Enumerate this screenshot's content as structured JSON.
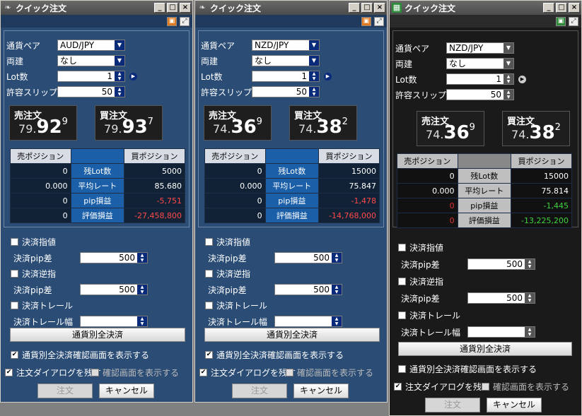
{
  "windows": [
    {
      "theme": "blue",
      "title": "クイック注文",
      "minimize_glyph": "_",
      "restore_glyph": "□",
      "close_glyph": "×",
      "pair_label": "通貨ペア",
      "pair_value": "AUD/JPY",
      "hedge_label": "両建",
      "hedge_value": "なし",
      "lot_label": "Lot数",
      "lot_value": "1",
      "slip_label": "許容スリップ",
      "slip_value": "50",
      "sell_title": "売注文",
      "sell_p1": "79.",
      "sell_p2": "92",
      "sell_p3": "9",
      "buy_title": "買注文",
      "buy_p1": "79.",
      "buy_p2": "93",
      "buy_p3": "7",
      "pos_header_sell": "売ポジション",
      "pos_header_buy": "買ポジション",
      "pos_rows": [
        {
          "sell": "0",
          "label": "残Lot数",
          "buy": "5000"
        },
        {
          "sell": "0.000",
          "label": "平均レート",
          "buy": "85.680"
        },
        {
          "sell": "0",
          "label": "pip損益",
          "buy": "-5,751"
        },
        {
          "sell": "0",
          "label": "評価損益",
          "buy": "-27,458,800"
        }
      ],
      "limit_label": "決済指値",
      "limit_pip_label": "決済pip差",
      "limit_pip_value": "500",
      "stop_label": "決済逆指",
      "stop_pip_label": "決済pip差",
      "stop_pip_value": "500",
      "trail_label": "決済トレール",
      "trail_width_label": "決済トレール幅",
      "trail_width_value": "",
      "close_all_label": "通貨別全決済",
      "show_confirm_closeall_label": "通貨別全決済確認画面を表示する",
      "keep_dialog_label": "注文ダイアログを残す",
      "show_confirm_label": "確認画面を表示する",
      "order_label": "注文",
      "cancel_label": "キャンセル"
    },
    {
      "theme": "blue",
      "title": "クイック注文",
      "minimize_glyph": "_",
      "restore_glyph": "□",
      "close_glyph": "×",
      "pair_label": "通貨ペア",
      "pair_value": "NZD/JPY",
      "hedge_label": "両建",
      "hedge_value": "なし",
      "lot_label": "Lot数",
      "lot_value": "1",
      "slip_label": "許容スリップ",
      "slip_value": "50",
      "sell_title": "売注文",
      "sell_p1": "74.",
      "sell_p2": "36",
      "sell_p3": "9",
      "buy_title": "買注文",
      "buy_p1": "74.",
      "buy_p2": "38",
      "buy_p3": "2",
      "pos_header_sell": "売ポジション",
      "pos_header_buy": "買ポジション",
      "pos_rows": [
        {
          "sell": "0",
          "label": "残Lot数",
          "buy": "15000"
        },
        {
          "sell": "0.000",
          "label": "平均レート",
          "buy": "75.847"
        },
        {
          "sell": "0",
          "label": "pip損益",
          "buy": "-1,478"
        },
        {
          "sell": "0",
          "label": "評価損益",
          "buy": "-14,768,000"
        }
      ],
      "limit_label": "決済指値",
      "limit_pip_label": "決済pip差",
      "limit_pip_value": "500",
      "stop_label": "決済逆指",
      "stop_pip_label": "決済pip差",
      "stop_pip_value": "500",
      "trail_label": "決済トレール",
      "trail_width_label": "決済トレール幅",
      "trail_width_value": "",
      "close_all_label": "通貨別全決済",
      "show_confirm_closeall_label": "通貨別全決済確認画面を表示する",
      "keep_dialog_label": "注文ダイアログを残す",
      "show_confirm_label": "確認画面を表示する",
      "order_label": "注文",
      "cancel_label": "キャンセル"
    },
    {
      "theme": "dark",
      "title": "クイック注文",
      "minimize_glyph": "_",
      "restore_glyph": "□",
      "close_glyph": "×",
      "pair_label": "通貨ペア",
      "pair_value": "NZD/JPY",
      "hedge_label": "両建",
      "hedge_value": "なし",
      "lot_label": "Lot数",
      "lot_value": "1",
      "slip_label": "許容スリップ",
      "slip_value": "50",
      "sell_title": "売注文",
      "sell_p1": "74.",
      "sell_p2": "36",
      "sell_p3": "9",
      "buy_title": "買注文",
      "buy_p1": "74.",
      "buy_p2": "38",
      "buy_p3": "2",
      "pos_header_sell": "売ポジション",
      "pos_header_buy": "買ポジション",
      "pos_rows": [
        {
          "sell": "0",
          "label": "残Lot数",
          "buy": "15000"
        },
        {
          "sell": "0.000",
          "label": "平均レート",
          "buy": "75.814"
        },
        {
          "sell": "0",
          "label": "pip損益",
          "buy": "-1,445"
        },
        {
          "sell": "0",
          "label": "評価損益",
          "buy": "-13,225,200"
        }
      ],
      "limit_label": "決済指値",
      "limit_pip_label": "決済pip差",
      "limit_pip_value": "500",
      "stop_label": "決済逆指",
      "stop_pip_label": "決済pip差",
      "stop_pip_value": "500",
      "trail_label": "決済トレール",
      "trail_width_label": "決済トレール幅",
      "trail_width_value": "",
      "close_all_label": "通貨別全決済",
      "show_confirm_closeall_label": "通貨別全決済確認画面を表示する",
      "keep_dialog_label": "注文ダイアログを残す",
      "show_confirm_label": "確認画面を表示する",
      "order_label": "注文",
      "cancel_label": "キャンセル"
    }
  ],
  "icons": {
    "app_icon": "app-icon",
    "pin_icon": "pin-icon",
    "expand_icon": "expand-icon",
    "arrow_icon": "dropdown-arrow-icon",
    "play_icon": "play-icon"
  },
  "colors": {
    "blue_bg": "#2a4c75",
    "blue_table_cell": "#112236",
    "blue_table_mid": "#1a5fa8",
    "blue_header": "#d8dde5",
    "dark_bg": "#1a1a1a",
    "dark_table_cell": "#111111",
    "dark_table_mid": "#bfbfbf",
    "loss_red": "#ff4a4a",
    "gain_green": "#3fd43f",
    "zero_red": "#e03030"
  }
}
